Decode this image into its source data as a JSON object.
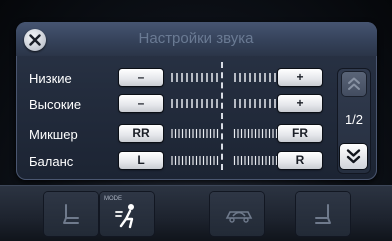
{
  "header": {
    "title": "Настройки звука",
    "page": "1/2"
  },
  "rows": [
    {
      "label": "Низкие",
      "left": "–",
      "right": "+"
    },
    {
      "label": "Высокие",
      "left": "–",
      "right": "+"
    },
    {
      "label": "Микшер",
      "left": "RR",
      "right": "FR"
    },
    {
      "label": "Баланс",
      "left": "L",
      "right": "R"
    }
  ],
  "dock": {
    "mode_label": "MODE"
  },
  "icons": {
    "close": "close-icon",
    "up": "chevron-up-double-icon",
    "down": "chevron-down-double-icon",
    "seat_left": "seat-heat-icon",
    "fan_mode": "fan-mode-icon",
    "recirc": "air-recirculation-icon",
    "seat_right": "seat-heat-icon"
  },
  "colors": {
    "panel": "#232c3d",
    "title": "#6a7a93",
    "button": "#ffffff"
  }
}
